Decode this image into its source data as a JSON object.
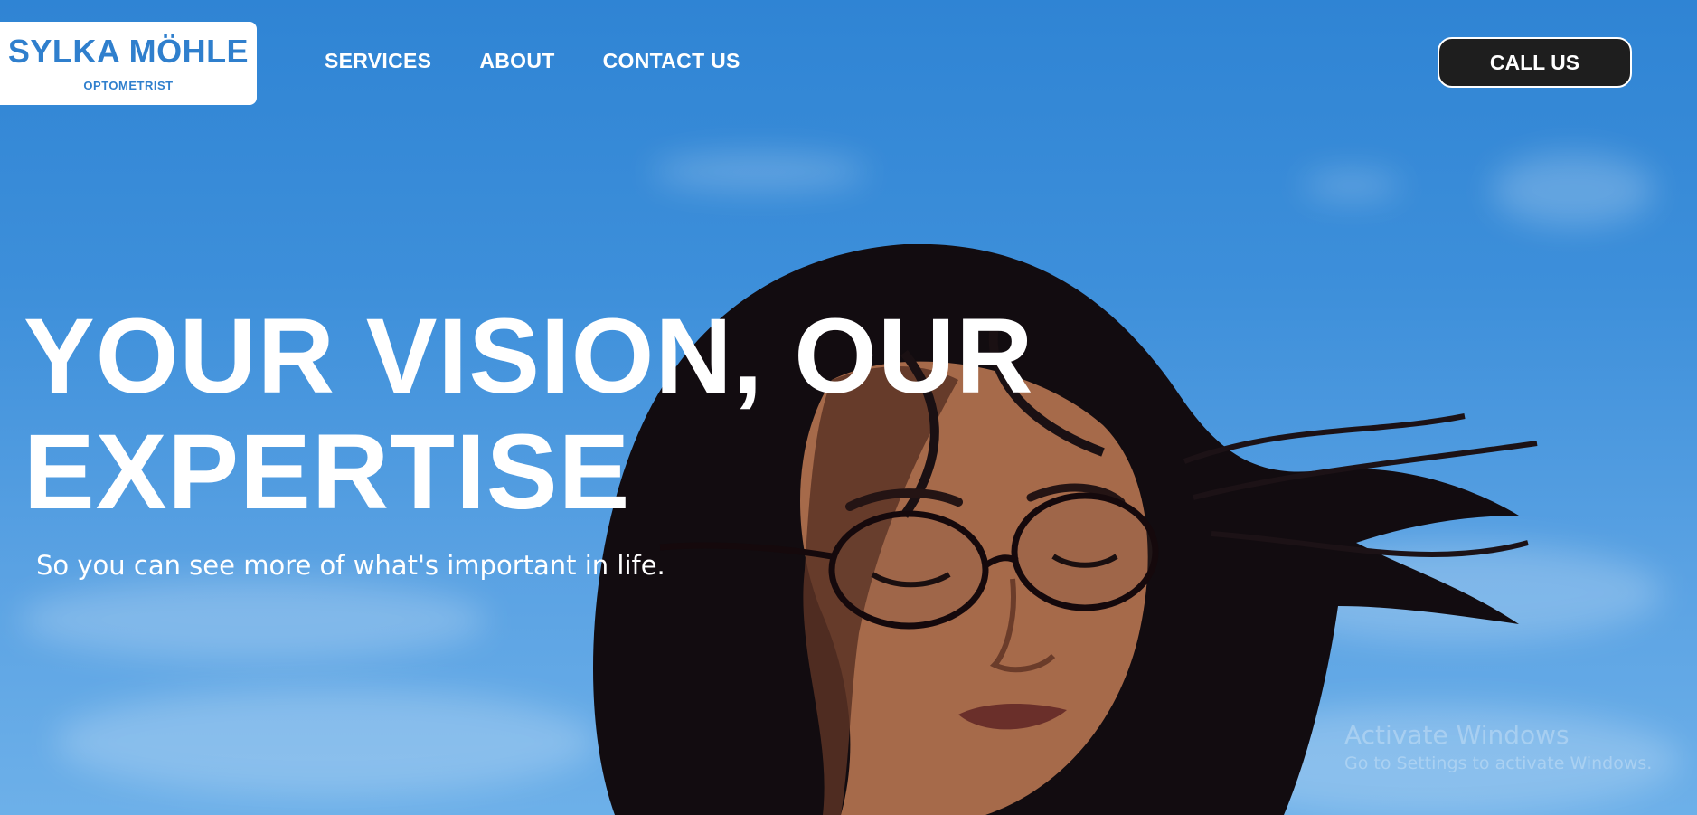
{
  "brand": {
    "name": "SYLKA MÖHLE",
    "subtitle": "OPTOMETRIST",
    "color": "#2f7fcd"
  },
  "nav": {
    "items": [
      {
        "label": "SERVICES"
      },
      {
        "label": "ABOUT"
      },
      {
        "label": "CONTACT US"
      }
    ]
  },
  "cta": {
    "label": "CALL US",
    "background": "#1e1e1e"
  },
  "hero": {
    "headline_line1": "YOUR VISION, OUR",
    "headline_line2": "EXPERTISE",
    "tagline": "So you can see more of what's important in life.",
    "sky_color": "#3d8fda"
  },
  "watermark": {
    "title": "Activate Windows",
    "subtitle": "Go to Settings to activate Windows."
  }
}
